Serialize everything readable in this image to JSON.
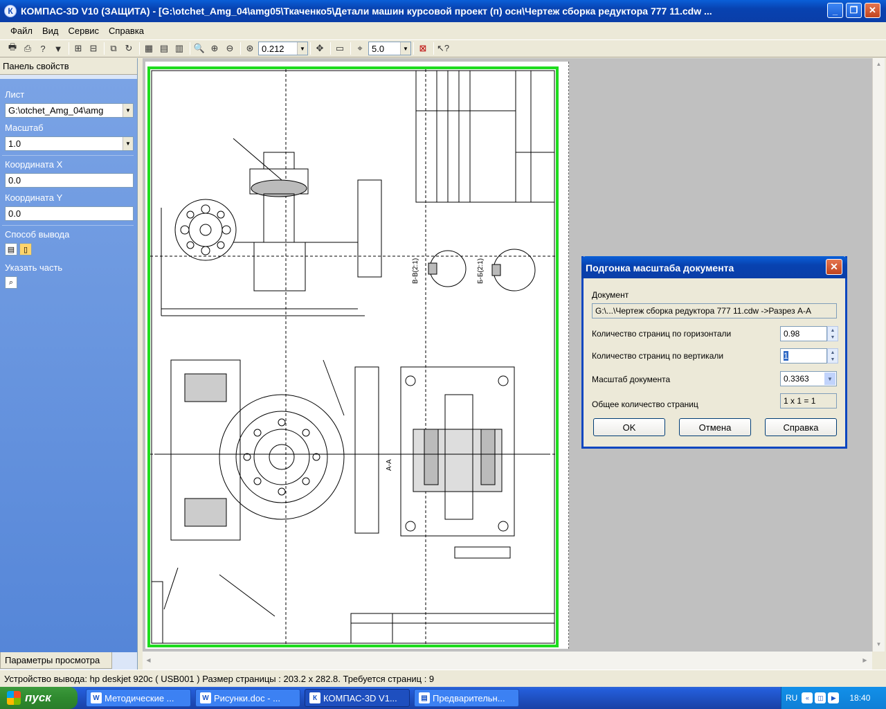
{
  "window": {
    "title": "КОМПАС-3D V10 (ЗАЩИТА) - [G:\\otchet_Amg_04\\amg05\\Ткаченко5\\Детали машин курсовой проект (п) осн\\Чертеж сборка  редуктора 777 11.cdw ...",
    "app_icon": "К"
  },
  "menu": [
    "Файл",
    "Вид",
    "Сервис",
    "Справка"
  ],
  "toolbar": {
    "zoom_value": "0.212",
    "step_value": "5.0"
  },
  "panel": {
    "header": "Панель свойств",
    "sheet_label": "Лист",
    "sheet_value": "G:\\otchet_Amg_04\\amg",
    "scale_label": "Масштаб",
    "scale_value": "1.0",
    "coord_x_label": "Координата X",
    "coord_x_value": "0.0",
    "coord_y_label": "Координата Y",
    "coord_y_value": "0.0",
    "output_label": "Способ вывода",
    "part_label": "Указать часть",
    "tab_label": "Параметры просмотра"
  },
  "dialog": {
    "title": "Подгонка масштаба документа",
    "doc_label": "Документ",
    "doc_value": "G:\\...\\Чертеж сборка  редуктора 777 11.cdw ->Разрез А-А",
    "pages_h_label": "Количество страниц по горизонтали",
    "pages_h_value": "0.98",
    "pages_v_label": "Количество страниц по вертикали",
    "pages_v_value": "1",
    "scale_label": "Масштаб документа",
    "scale_value": "0.3363",
    "total_label": "Общее количество страниц",
    "total_value": "1 x 1 = 1",
    "ok": "OK",
    "cancel": "Отмена",
    "help": "Справка"
  },
  "drawing": {
    "section_labels": [
      "В-В(2:1)",
      "Б-Б(2:1)",
      "А-А"
    ]
  },
  "statusbar": {
    "text": "Устройство вывода: hp deskjet 920c ( USB001 )  Размер страницы : 203.2 x 282.8.  Требуется страниц : 9"
  },
  "taskbar": {
    "start": "пуск",
    "tasks": [
      "Методические ...",
      "Рисунки.doc - ...",
      "КОМПАС-3D V1...",
      "Предварительн..."
    ],
    "lang": "RU",
    "clock": "18:40"
  }
}
